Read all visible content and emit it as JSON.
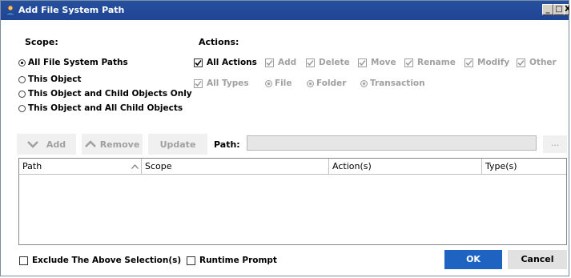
{
  "window": {
    "title": "Add File System Path",
    "controls": [
      "_",
      "□",
      "X"
    ]
  },
  "scope": {
    "label": "Scope:",
    "options": [
      {
        "label": "All File System Paths",
        "selected": true
      },
      {
        "label": "This Object",
        "selected": false
      },
      {
        "label": "This Object and Child Objects Only",
        "selected": false
      },
      {
        "label": "This Object and All Child Objects",
        "selected": false
      }
    ]
  },
  "actions": {
    "label": "Actions:",
    "all_actions": {
      "label": "All Actions",
      "checked": true
    },
    "items": [
      {
        "label": "Add",
        "checked": true
      },
      {
        "label": "Delete",
        "checked": true
      },
      {
        "label": "Move",
        "checked": true
      },
      {
        "label": "Rename",
        "checked": true
      },
      {
        "label": "Modify",
        "checked": true
      },
      {
        "label": "Other",
        "checked": true
      }
    ],
    "all_types": {
      "label": "All Types",
      "checked": true
    },
    "types": [
      {
        "label": "File",
        "selected": true
      },
      {
        "label": "Folder",
        "selected": true
      },
      {
        "label": "Transaction",
        "selected": true
      }
    ]
  },
  "toolbar": {
    "add_label": "Add",
    "remove_label": "Remove",
    "update_label": "Update",
    "path_label": "Path:",
    "path_value": "",
    "browse_label": "..."
  },
  "table": {
    "columns": [
      "Path",
      "Scope",
      "Action(s)",
      "Type(s)"
    ],
    "rows": []
  },
  "footer": {
    "exclude_label": "Exclude The Above Selection(s)",
    "runtime_label": "Runtime Prompt",
    "ok_label": "OK",
    "cancel_label": "Cancel"
  },
  "colors": {
    "titlebar": "#1f4594",
    "ok_button": "#1f63c2",
    "disabled_text": "#a0a0a0"
  }
}
